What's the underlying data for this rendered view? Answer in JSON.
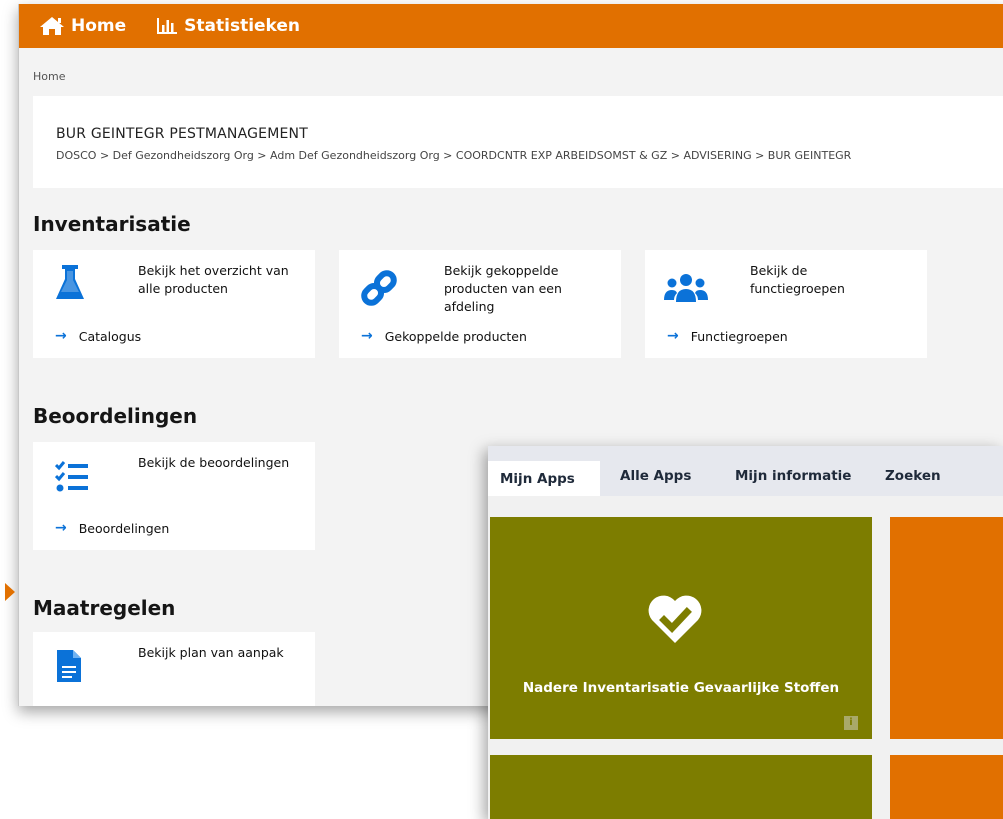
{
  "topbar": {
    "home_label": "Home",
    "statistics_label": "Statistieken",
    "color": "#e17000"
  },
  "breadcrumb": "Home",
  "organization": {
    "title": "BUR GEINTEGR PESTMANAGEMENT",
    "path": "DOSCO > Def Gezondheidszorg Org > Adm Def Gezondheidszorg Org > COORDCNTR EXP ARBEIDSOMST & GZ > ADVISERING > BUR GEINTEGR"
  },
  "sections": {
    "inventarisatie": {
      "title": "Inventarisatie",
      "cards": [
        {
          "icon": "flask-icon",
          "desc_lines": [
            "Bekijk het overzicht van",
            "alle producten"
          ],
          "link": "Catalogus"
        },
        {
          "icon": "link-icon",
          "desc_lines": [
            "Bekijk gekoppelde",
            "producten van een",
            "afdeling"
          ],
          "link": "Gekoppelde producten"
        },
        {
          "icon": "users-icon",
          "desc_lines": [
            "Bekijk de",
            "functiegroepen"
          ],
          "link": "Functiegroepen"
        }
      ]
    },
    "beoordelingen": {
      "title": "Beoordelingen",
      "cards": [
        {
          "icon": "checklist-icon",
          "desc_lines": [
            "Bekijk de beoordelingen"
          ],
          "link": "Beoordelingen"
        }
      ]
    },
    "maatregelen": {
      "title": "Maatregelen",
      "cards": [
        {
          "icon": "document-icon",
          "desc_lines": [
            "Bekijk plan van aanpak"
          ]
        }
      ]
    }
  },
  "overlay": {
    "tabs": [
      "Mijn Apps",
      "Alle Apps",
      "Mijn informatie",
      "Zoeken"
    ],
    "active_tab": "Mijn Apps",
    "tile": {
      "label": "Nadere Inventarisatie Gevaarlijke Stoffen",
      "icon": "heart-check-icon",
      "info_glyph": "i",
      "color": "#7d7d00"
    },
    "accent_tile_color": "#e17000"
  }
}
